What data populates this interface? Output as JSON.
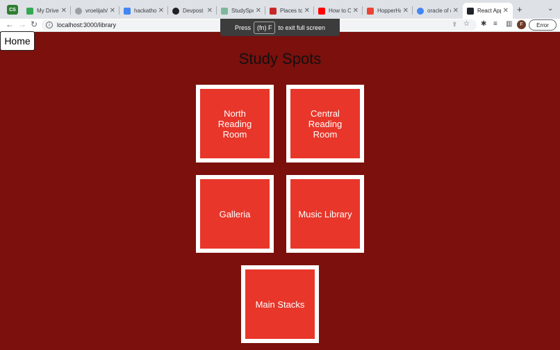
{
  "browser": {
    "profile_chip": "CS",
    "tabs": [
      {
        "title": "My Drive -",
        "color": "#34a853"
      },
      {
        "title": "vroelijah/R",
        "color": "#9aa0a6"
      },
      {
        "title": "hackathon",
        "color": "#4285f4"
      },
      {
        "title": "Devpost",
        "color": "#202124"
      },
      {
        "title": "StudySpo",
        "color": "#7cb99b"
      },
      {
        "title": "Places to s",
        "color": "#c62828"
      },
      {
        "title": "How to Op",
        "color": "#ff0000"
      },
      {
        "title": "HopperHa",
        "color": "#ea4335"
      },
      {
        "title": "oracle of d",
        "color": "#4285f4"
      },
      {
        "title": "React App",
        "color": "#20232a"
      }
    ],
    "url": "localhost:3000/library",
    "avatar_letter": "F",
    "error_label": "Error"
  },
  "toast": {
    "press": "Press",
    "key": "(fn) F",
    "message": "to exit full screen"
  },
  "page": {
    "home_label": "Home",
    "title": "Study Spots",
    "spots": [
      "North Reading Room",
      "Central Reading Room",
      "Galleria",
      "Music Library",
      "Main Stacks"
    ]
  }
}
